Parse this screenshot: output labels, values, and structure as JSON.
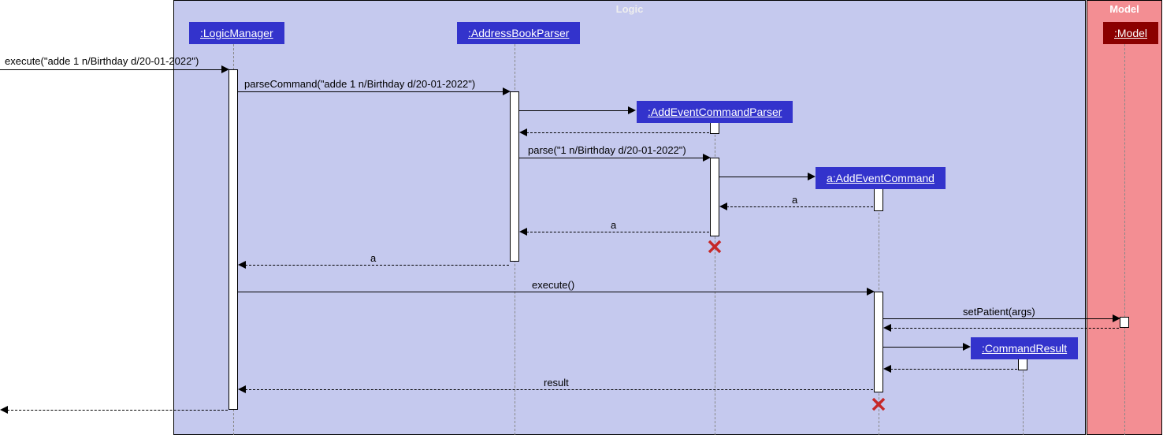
{
  "regions": {
    "logic": {
      "label": "Logic"
    },
    "model": {
      "label": "Model"
    }
  },
  "participants": {
    "logicManager": ":LogicManager",
    "parser": ":AddressBookParser",
    "aecp": ":AddEventCommandParser",
    "aec": "a:AddEventCommand",
    "cmdres": ":CommandResult",
    "model": ":Model"
  },
  "messages": {
    "m1": "execute(\"adde 1 n/Birthday d/20-01-2022\")",
    "m2": "parseCommand(\"adde 1 n/Birthday d/20-01-2022\")",
    "m4": "parse(\"1 n/Birthday d/20-01-2022\")",
    "m6": "a",
    "m7": "a",
    "m8": "a",
    "m9": "execute()",
    "m10": "setPatient(args)",
    "m12": "result"
  }
}
